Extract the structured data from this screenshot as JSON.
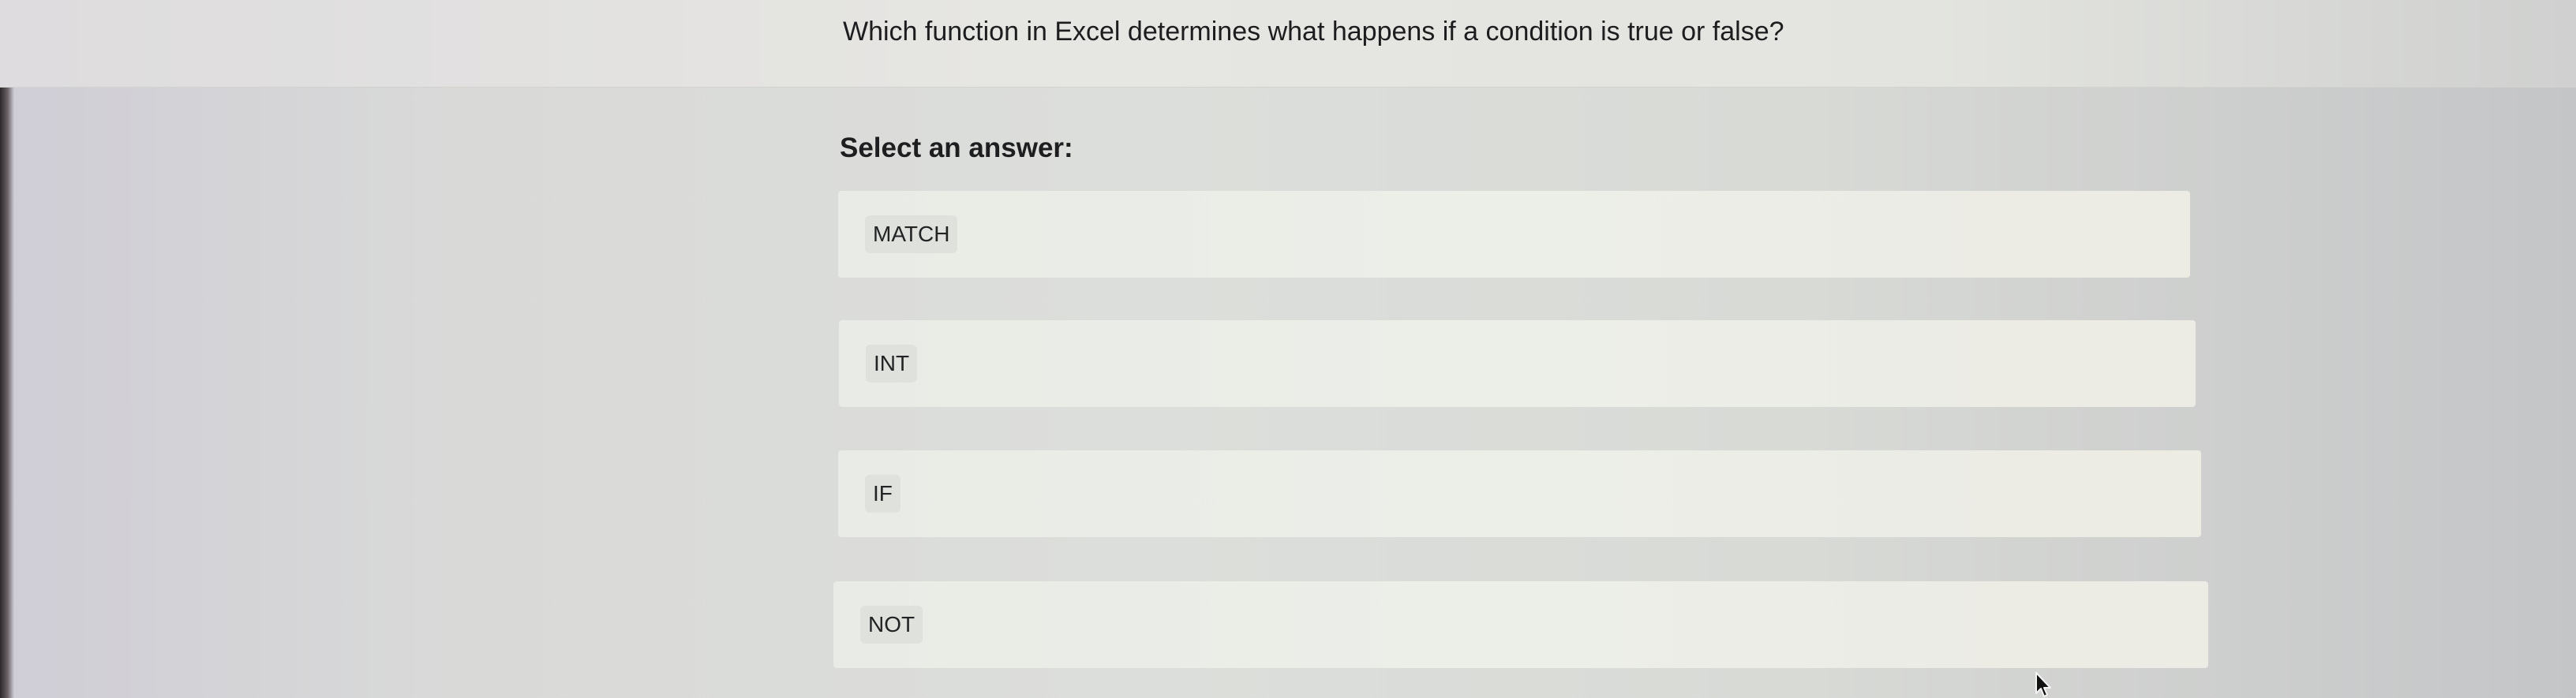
{
  "question": {
    "text": "Which function in Excel determines what happens if a condition is true or false?"
  },
  "answers": {
    "prompt": "Select an answer:",
    "options": [
      {
        "label": "MATCH"
      },
      {
        "label": "INT"
      },
      {
        "label": "IF"
      },
      {
        "label": "NOT"
      }
    ]
  },
  "colors": {
    "background": "#dcdedb",
    "option_background": "#eceee8",
    "text": "#1d1d1f"
  },
  "icons": {
    "cursor": "mouse-pointer-icon"
  }
}
